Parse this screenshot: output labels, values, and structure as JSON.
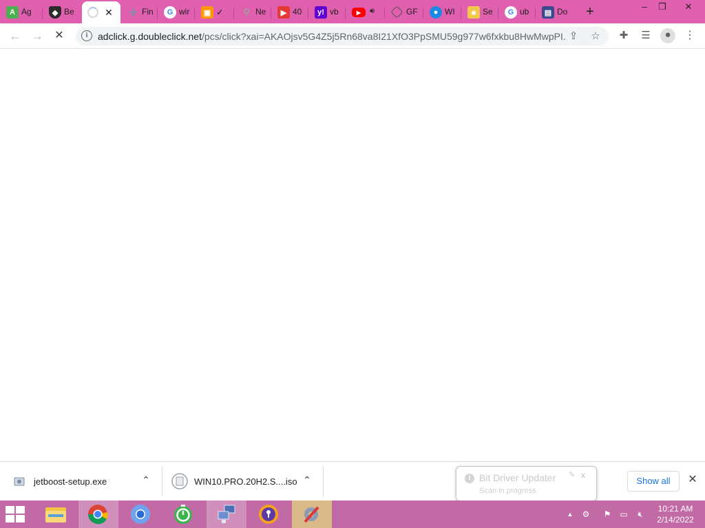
{
  "browser": {
    "tabs": [
      {
        "title": "Ag",
        "icon": "android-icon",
        "color": "#4caf50"
      },
      {
        "title": "Be",
        "icon": "shield-icon",
        "color": "#2b2b2b"
      },
      {
        "title": "",
        "icon": "loading-spinner",
        "color": "#a9c2f2",
        "active": true
      },
      {
        "title": "Fin",
        "icon": "tools-icon",
        "color": "#7b8fa8"
      },
      {
        "title": "wir",
        "icon": "google-icon",
        "color": "#4285f4"
      },
      {
        "title": "",
        "icon": "gallery-icon",
        "color": "#ff9800"
      },
      {
        "title": "Ne",
        "icon": "search-icon",
        "color": "#9e9e9e"
      },
      {
        "title": "40",
        "icon": "video-icon",
        "color": "#e53935"
      },
      {
        "title": "vb",
        "icon": "yahoo-icon",
        "color": "#6001d2"
      },
      {
        "title": "",
        "icon": "youtube-icon",
        "color": "#ff0000"
      },
      {
        "title": "GF",
        "icon": "diamond-icon",
        "color": "#ffffff"
      },
      {
        "title": "WI",
        "icon": "wireless-icon",
        "color": "#1e88e5"
      },
      {
        "title": "Se",
        "icon": "lock-icon",
        "color": "#f2c94c"
      },
      {
        "title": "ub",
        "icon": "google-icon",
        "color": "#4285f4"
      },
      {
        "title": "Do",
        "icon": "doc-icon",
        "color": "#3a4a8c"
      }
    ],
    "new_tab_label": "+",
    "window_controls": {
      "minimize": "–",
      "restore": "❐",
      "close": "✕"
    }
  },
  "toolbar": {
    "url_host": "adclick.g.doubleclick.net",
    "url_path": "/pcs/click?xai=AKAOjsv5G4Z5j5Rn68va8I21XfO3PpSMU59g977w6fxkbu8HwMwpPI...",
    "back_icon": "←",
    "forward_icon": "→",
    "stop_icon": "✕",
    "info_icon": "i"
  },
  "downloads": {
    "items": [
      {
        "name": "jetboost-setup.exe"
      },
      {
        "name": "WIN10.PRO.20H2.S....iso"
      }
    ],
    "show_all": "Show all",
    "close": "✕"
  },
  "toast": {
    "title": "Bit Driver Updater",
    "subtitle": "Scan in progress",
    "close": "x"
  },
  "taskbar": {
    "time": "10:21 AM",
    "date": "2/14/2022"
  },
  "colors": {
    "tabstrip": "#e05fae",
    "taskbar": "#c26aa6",
    "link": "#1a73e8"
  }
}
